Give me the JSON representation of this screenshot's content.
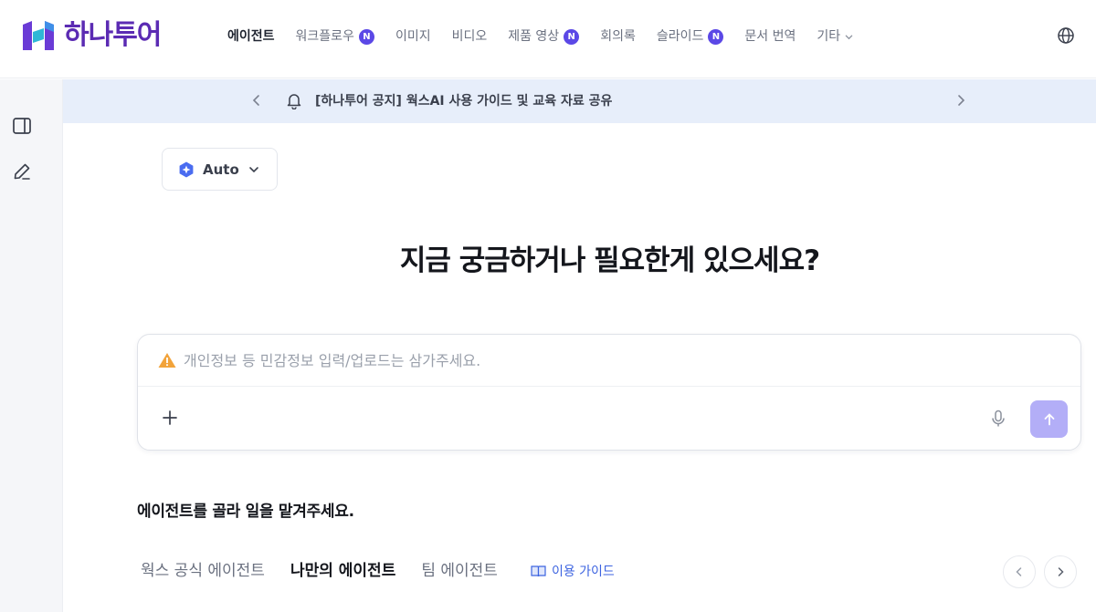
{
  "brand": {
    "name": "하나투어",
    "color": "#5b2bb3"
  },
  "nav": {
    "items": [
      {
        "label": "에이전트",
        "active": true
      },
      {
        "label": "워크플로우",
        "badge": "N"
      },
      {
        "label": "이미지"
      },
      {
        "label": "비디오"
      },
      {
        "label": "제품 영상",
        "badge": "N"
      },
      {
        "label": "회의록"
      },
      {
        "label": "슬라이드",
        "badge": "N"
      },
      {
        "label": "문서 번역"
      },
      {
        "label": "기타",
        "dropdown": true
      }
    ]
  },
  "header_icons": {
    "language": "globe-icon"
  },
  "sidebar": {
    "icons": [
      "sidebar-panel-icon",
      "edit-pencil-icon"
    ]
  },
  "notice": {
    "text": "[하나투어 공지]  웍스AI 사용 가이드 및 교육 자료 공유"
  },
  "model_selector": {
    "label": "Auto"
  },
  "headline": "지금 궁금하거나 필요한게 있으세요?",
  "composer": {
    "placeholder": "개인정보 등 민감정보 입력/업로드는 삼가주세요.",
    "value": "",
    "send_color": "#b3aef7"
  },
  "agents_section": {
    "title": "에이전트를 골라 일을 맡겨주세요.",
    "tabs": [
      {
        "label": "웍스 공식 에이전트"
      },
      {
        "label": "나만의 에이전트",
        "active": true
      },
      {
        "label": "팀 에이전트"
      }
    ],
    "guide_label": "이용 가이드"
  },
  "colors": {
    "accent": "#5b48e6",
    "notice_bg": "#e7eefa",
    "link": "#3c63e0"
  }
}
